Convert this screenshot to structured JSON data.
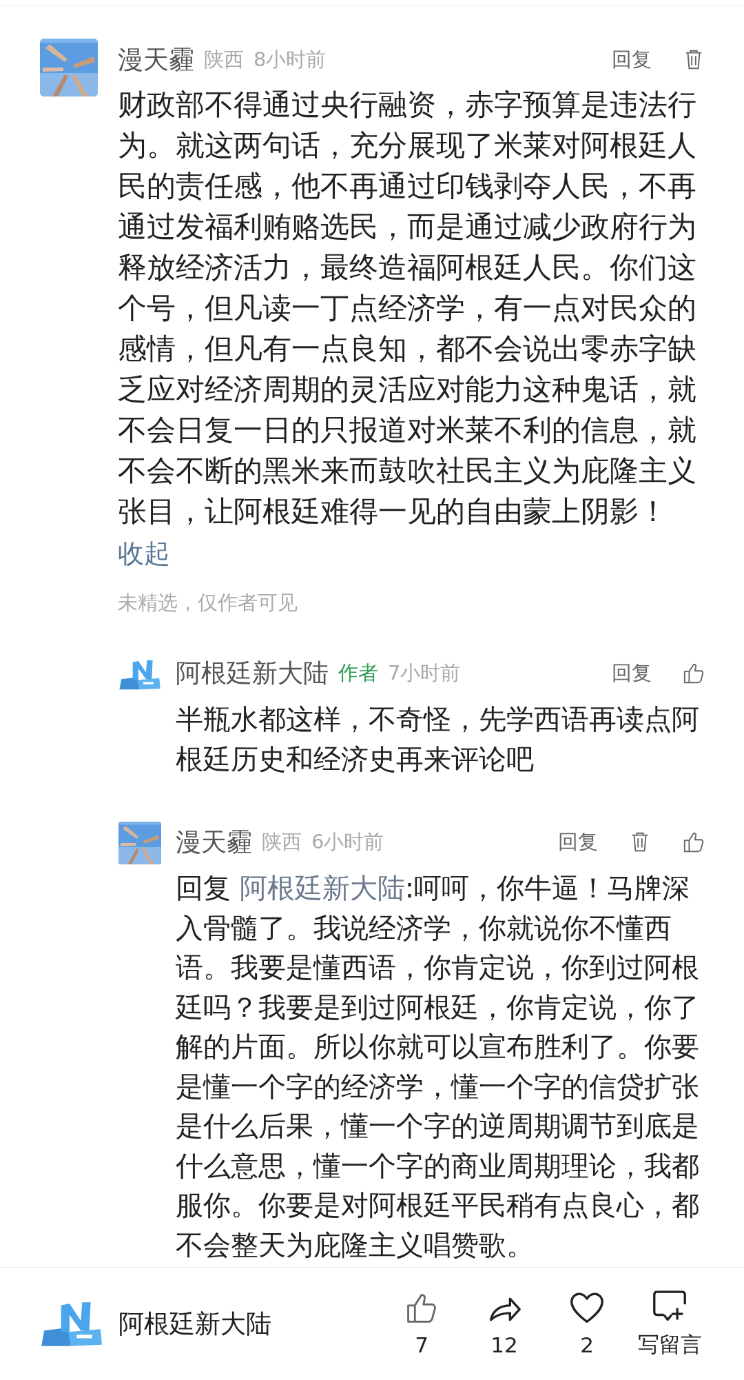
{
  "comment": {
    "author": "漫天霾",
    "location": "陕西",
    "time": "8小时前",
    "actions": [
      {
        "kind": "reply",
        "label": "回复"
      },
      {
        "kind": "delete"
      }
    ],
    "text": "财政部不得通过央行融资，赤字预算是违法行为。就这两句话，充分展现了米莱对阿根廷人民的责任感，他不再通过印钱剥夺人民，不再通过发福利贿赂选民，而是通过减少政府行为释放经济活力，最终造福阿根廷人民。你们这个号，但凡读一丁点经济学，有一点对民众的感情，但凡有一点良知，都不会说出零赤字缺乏应对经济周期的灵活应对能力这种鬼话，就不会日复一日的只报道对米莱不利的信息，就不会不断的黑米来而鼓吹社民主义为庇隆主义张目，让阿根廷难得一见的自由蒙上阴影！",
    "collapse": "收起",
    "status": "未精选，仅作者可见"
  },
  "replies": [
    {
      "kind": "author_reply",
      "author": "阿根廷新大陆",
      "badge": "作者",
      "time": "7小时前",
      "actions": [
        {
          "kind": "reply",
          "label": "回复"
        },
        {
          "kind": "like"
        }
      ],
      "text": "半瓶水都这样，不奇怪，先学西语再读点阿根廷历史和经济史再来评论吧"
    },
    {
      "kind": "user_reply",
      "author": "漫天霾",
      "location": "陕西",
      "time": "6小时前",
      "actions": [
        {
          "kind": "reply",
          "label": "回复"
        },
        {
          "kind": "delete"
        },
        {
          "kind": "like"
        }
      ],
      "reply_prefix": "回复",
      "reply_to": "阿根廷新大陆",
      "text": ":呵呵，你牛逼！马牌深入骨髓了。我说经济学，你就说你不懂西语。我要是懂西语，你肯定说，你到过阿根廷吗？我要是到过阿根廷，你肯定说，你了解的片面。所以你就可以宣布胜利了。你要是懂一个字的经济学，懂一个字的信贷扩张是什么后果，懂一个字的逆周期调节到底是什么意思，懂一个字的商业周期理论，我都服你。你要是对阿根廷平民稍有点良心，都不会整天为庇隆主义唱赞歌。"
    }
  ],
  "bottom_bar": {
    "account": "阿根廷新大陆",
    "actions": [
      {
        "kind": "like",
        "label": "7"
      },
      {
        "kind": "share",
        "label": "12"
      },
      {
        "kind": "favorite",
        "label": "2"
      },
      {
        "kind": "comment",
        "label": "写留言"
      }
    ]
  }
}
